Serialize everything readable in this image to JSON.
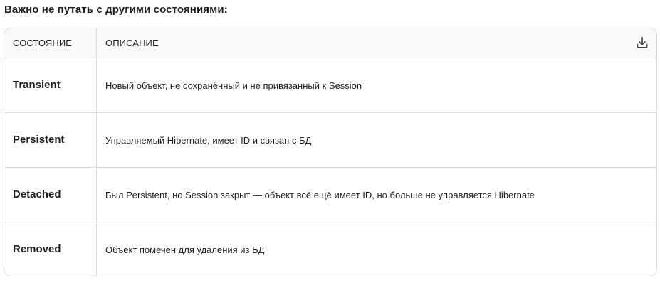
{
  "heading": "Важно не путать с другими состояниями:",
  "table": {
    "headers": {
      "state": "Состояние",
      "description": "Описание"
    },
    "download_icon": "download-icon",
    "rows": [
      {
        "state": "Transient",
        "description": "Новый объект, не сохранённый и не привязанный к Session"
      },
      {
        "state": "Persistent",
        "description": "Управляемый Hibernate, имеет ID и связан с БД"
      },
      {
        "state": "Detached",
        "description": "Был Persistent, но Session закрыт — объект всё ещё имеет ID, но больше не управляется Hibernate"
      },
      {
        "state": "Removed",
        "description": "Объект помечен для удаления из БД"
      }
    ]
  },
  "colors": {
    "border": "#dadce0",
    "header_bg": "#f8f9fa",
    "text": "#1f1f1f"
  }
}
